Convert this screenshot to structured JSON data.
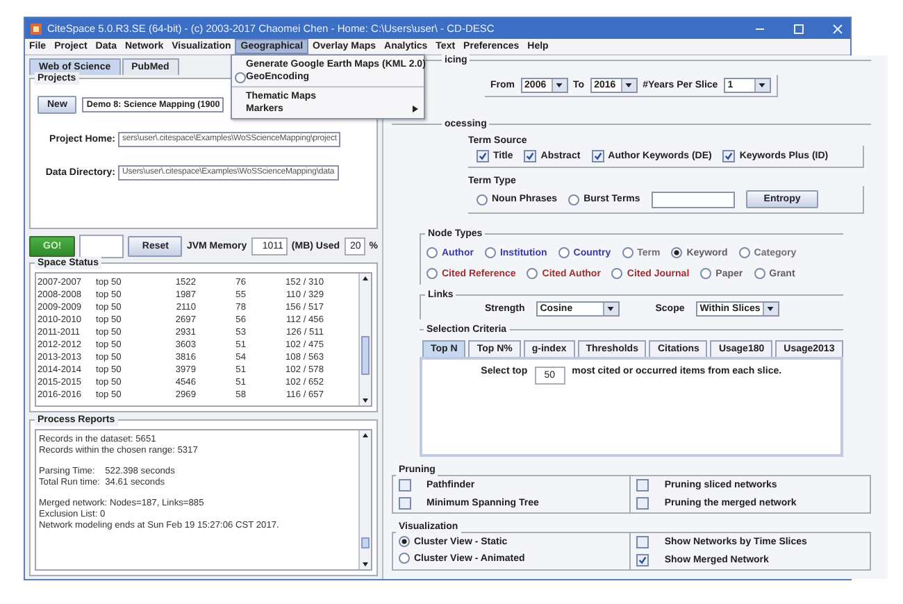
{
  "window": {
    "title": "CiteSpace 5.0.R3.SE (64-bit) - (c) 2003-2017 Chaomei Chen - Home: C:\\Users\\user\\ - CD-DESC"
  },
  "menu": [
    {
      "label": "File",
      "selected": false
    },
    {
      "label": "Project",
      "selected": false
    },
    {
      "label": "Data",
      "selected": false
    },
    {
      "label": "Network",
      "selected": false
    },
    {
      "label": "Visualization",
      "selected": false
    },
    {
      "label": "Geographical",
      "selected": true
    },
    {
      "label": "Overlay Maps",
      "selected": false
    },
    {
      "label": "Analytics",
      "selected": false
    },
    {
      "label": "Text",
      "selected": false
    },
    {
      "label": "Preferences",
      "selected": false
    },
    {
      "label": "Help",
      "selected": false
    }
  ],
  "dropdown": {
    "items": [
      {
        "kind": "item",
        "label": "Generate Google Earth Maps (KML 2.0)"
      },
      {
        "kind": "radio",
        "label": "GeoEncoding",
        "checked": false
      },
      {
        "kind": "separator"
      },
      {
        "kind": "item",
        "label": "Thematic Maps"
      },
      {
        "kind": "item",
        "label": "Markers",
        "submenu": true
      }
    ]
  },
  "source_tabs": [
    {
      "label": "Web of Science",
      "selected": true
    },
    {
      "label": "PubMed",
      "selected": false
    }
  ],
  "projects": {
    "title": "Projects",
    "new_button": "New",
    "project": "Demo 8: Science Mapping (1900",
    "fields": [
      {
        "label": "Project Home:",
        "value": "sers\\user\\.citespace\\Examples\\WoSScienceMapping\\project"
      },
      {
        "label": "Data Directory:",
        "value": "Users\\user\\.citespace\\Examples\\WoSScienceMapping\\data"
      }
    ]
  },
  "controls": {
    "go": "GO!",
    "reset": "Reset",
    "jvm_label": "JVM Memory",
    "memory": "1011",
    "used_label": "(MB) Used",
    "used": "20",
    "percent": "%"
  },
  "space_status": {
    "title": "Space Status",
    "rows": [
      [
        "2007-2007",
        "top 50",
        "1522",
        "76",
        "152 / 310"
      ],
      [
        "2008-2008",
        "top 50",
        "1987",
        "55",
        "110 / 329"
      ],
      [
        "2009-2009",
        "top 50",
        "2110",
        "78",
        "156 / 517"
      ],
      [
        "2010-2010",
        "top 50",
        "2697",
        "56",
        "112 / 456"
      ],
      [
        "2011-2011",
        "top 50",
        "2931",
        "53",
        "126 / 511"
      ],
      [
        "2012-2012",
        "top 50",
        "3603",
        "51",
        "102 / 475"
      ],
      [
        "2013-2013",
        "top 50",
        "3816",
        "54",
        "108 / 563"
      ],
      [
        "2014-2014",
        "top 50",
        "3979",
        "51",
        "102 / 578"
      ],
      [
        "2015-2015",
        "top 50",
        "4546",
        "51",
        "102 / 652"
      ],
      [
        "2016-2016",
        "top 50",
        "2969",
        "58",
        "116 / 657"
      ]
    ]
  },
  "process_reports": {
    "title": "Process Reports",
    "blocks": [
      [
        "Records in the dataset: 5651",
        "Records within the chosen range: 5317"
      ],
      [
        "Parsing Time:    522.398 seconds",
        "Total Run time:  34.61 seconds"
      ],
      [
        "Merged network: Nodes=187, Links=885",
        "Exclusion List: 0",
        "Network modeling ends at Sun Feb 19 15:27:06 CST 2017."
      ]
    ]
  },
  "time_slicing": {
    "title": "icing",
    "from_label": "From",
    "from": "2006",
    "to_label": "To",
    "to": "2016",
    "per_label": "#Years Per Slice",
    "per": "1"
  },
  "text_processing": {
    "title": "ocessing",
    "term_source": {
      "title": "Term Source",
      "options": [
        {
          "label": "Title",
          "checked": true
        },
        {
          "label": "Abstract",
          "checked": true
        },
        {
          "label": "Author Keywords (DE)",
          "checked": true
        },
        {
          "label": "Keywords Plus (ID)",
          "checked": true
        }
      ]
    },
    "term_type": {
      "title": "Term Type",
      "options": [
        {
          "label": "Noun Phrases",
          "selected": false
        },
        {
          "label": "Burst Terms",
          "selected": false
        }
      ],
      "button": "Entropy"
    }
  },
  "node_types": {
    "title": "Node Types",
    "rows": [
      {
        "options": [
          {
            "label": "Author",
            "selected": false,
            "color": "#3a3aa8"
          },
          {
            "label": "Institution",
            "selected": false,
            "color": "#3a3aa8"
          },
          {
            "label": "Country",
            "selected": false,
            "color": "#3a3aa8"
          },
          {
            "label": "Term",
            "selected": false,
            "color": "#707070"
          },
          {
            "label": "Keyword",
            "selected": true,
            "color": "#606060"
          },
          {
            "label": "Category",
            "selected": false,
            "color": "#707070"
          }
        ]
      },
      {
        "options": [
          {
            "label": "Cited Reference",
            "selected": false,
            "color": "#a03030"
          },
          {
            "label": "Cited Author",
            "selected": false,
            "color": "#a03030"
          },
          {
            "label": "Cited Journal",
            "selected": false,
            "color": "#a03030"
          },
          {
            "label": "Paper",
            "selected": false,
            "color": "#606060"
          },
          {
            "label": "Grant",
            "selected": false,
            "color": "#606060"
          }
        ]
      }
    ]
  },
  "links": {
    "title": "Links",
    "strength_label": "Strength",
    "strength": "Cosine",
    "scope_label": "Scope",
    "scope": "Within Slices"
  },
  "selection_criteria": {
    "title": "Selection Criteria",
    "tabs": [
      {
        "label": "Top N",
        "selected": true
      },
      {
        "label": "Top N%",
        "selected": false
      },
      {
        "label": "g-index",
        "selected": false
      },
      {
        "label": "Thresholds",
        "selected": false
      },
      {
        "label": "Citations",
        "selected": false
      },
      {
        "label": "Usage180",
        "selected": false
      },
      {
        "label": "Usage2013",
        "selected": false
      }
    ],
    "prefix": "Select top",
    "value": "50",
    "suffix": "most cited or occurred items from each slice."
  },
  "pruning": {
    "title": "Pruning",
    "options": [
      {
        "label": "Pathfinder",
        "checked": false
      },
      {
        "label": "Minimum Spanning Tree",
        "checked": false
      },
      {
        "label": "Pruning sliced networks",
        "checked": false
      },
      {
        "label": "Pruning the merged network",
        "checked": false
      }
    ]
  },
  "visualization": {
    "title": "Visualization",
    "views": [
      {
        "label": "Cluster View - Static",
        "selected": true
      },
      {
        "label": "Cluster View - Animated",
        "selected": false
      }
    ],
    "options": [
      {
        "label": "Show Networks by Time Slices",
        "checked": false
      },
      {
        "label": "Show Merged Network",
        "checked": true
      }
    ]
  }
}
